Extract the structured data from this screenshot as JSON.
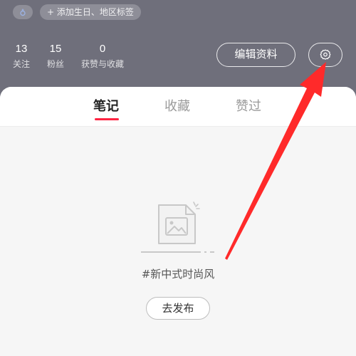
{
  "header": {
    "tag_label": "+ 添加生日、地区标签",
    "stats": [
      {
        "value": "13",
        "label": "关注"
      },
      {
        "value": "15",
        "label": "粉丝"
      },
      {
        "value": "0",
        "label": "获赞与收藏"
      }
    ],
    "edit_profile_label": "编辑资料",
    "settings_icon": "gear-icon",
    "background_color": "#6f6f7b"
  },
  "tabs": [
    {
      "label": "笔记",
      "active": true
    },
    {
      "label": "收藏",
      "active": false
    },
    {
      "label": "赞过",
      "active": false
    }
  ],
  "accent_color": "#ff2442",
  "empty_state": {
    "icon": "document-image-icon",
    "hashtag": "#新中式时尚风",
    "publish_label": "去发布"
  },
  "annotation": {
    "type": "arrow",
    "color": "#ff2a2a",
    "points_to": "settings-button"
  }
}
